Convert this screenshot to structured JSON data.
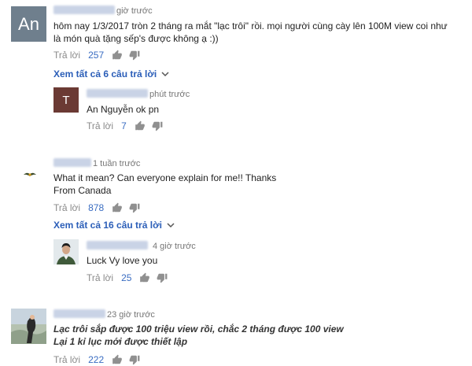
{
  "comments": [
    {
      "avatar_letter": "An",
      "avatar_color": "#6f7f8d",
      "time": "giờ trước",
      "text": "hôm nay 1/3/2017 tròn 2 tháng ra mắt \"lạc trôi\" rồi. mọi người cùng cày lên 100M view coi như là món quà tặng sếp's được không ạ :))",
      "reply_label": "Trả lời",
      "likes": "257",
      "view_replies": "Xem tất cả 6 câu trả lời",
      "reply": {
        "avatar_letter": "T",
        "avatar_color": "#6b3a34",
        "time": "phút trước",
        "text": "An Nguyễn ok pn",
        "reply_label": "Trả lời",
        "likes": "7"
      }
    },
    {
      "time": "1 tuần trước",
      "text_line1": "What it mean? Can everyone explain for me!! Thanks",
      "text_line2": "From Canada",
      "reply_label": "Trả lời",
      "likes": "878",
      "view_replies": "Xem tất cả 16 câu trả lời",
      "reply": {
        "time": "4 giờ trước",
        "text": "Luck Vy love you",
        "reply_label": "Trả lời",
        "likes": "25"
      }
    },
    {
      "time": "23 giờ trước",
      "text_line1": "Lạc trôi sắp được 100 triệu view rồi, chắc 2 tháng được 100 view",
      "text_line2": "Lại 1 kỉ lục mới được thiết lập",
      "reply_label": "Trả lời",
      "likes": "222"
    }
  ],
  "icons": {
    "thumb_up": "thumb-up-icon",
    "thumb_down": "thumb-down-icon",
    "chevron": "chevron-down-icon"
  }
}
